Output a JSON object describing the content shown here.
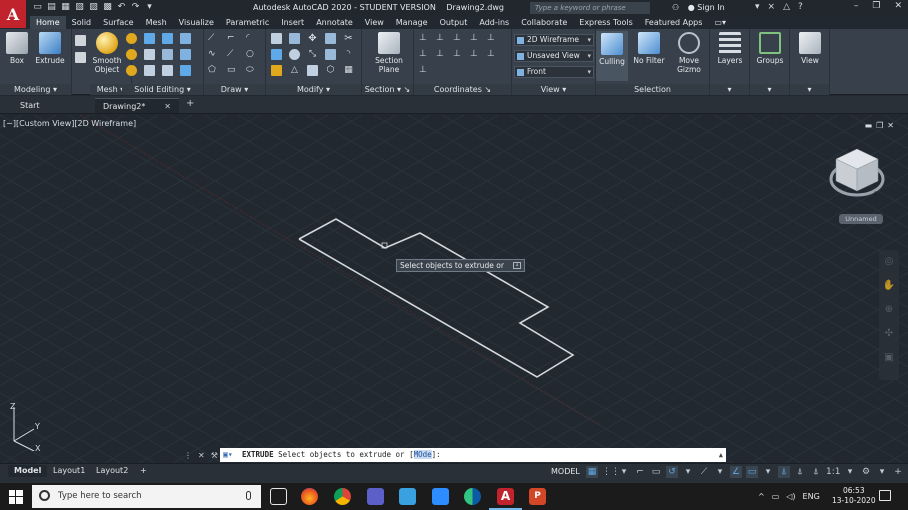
{
  "title_bar": {
    "app_name": "Autodesk AutoCAD 2020 - STUDENT VERSION",
    "document": "Drawing2.dwg",
    "search_placeholder": "Type a keyword or phrase",
    "signin_label": "Sign In",
    "logo_letter": "A"
  },
  "ribbon_tabs": [
    "Home",
    "Solid",
    "Surface",
    "Mesh",
    "Visualize",
    "Parametric",
    "Insert",
    "Annotate",
    "View",
    "Manage",
    "Output",
    "Add-ins",
    "Collaborate",
    "Express Tools",
    "Featured Apps"
  ],
  "ribbon": {
    "modeling": {
      "label": "Modeling",
      "box": "Box",
      "extrude": "Extrude"
    },
    "mesh": {
      "label": "Mesh",
      "smooth_object_1": "Smooth",
      "smooth_object_2": "Object"
    },
    "solid_editing": {
      "label": "Solid Editing"
    },
    "draw": {
      "label": "Draw"
    },
    "modify": {
      "label": "Modify"
    },
    "section": {
      "label": "Section",
      "section_plane_1": "Section",
      "section_plane_2": "Plane"
    },
    "coordinates": {
      "label": "Coordinates"
    },
    "view": {
      "label": "View",
      "visual_style": "2D Wireframe",
      "saved_view": "Unsaved View",
      "view_direction": "Front"
    },
    "selection": {
      "label": "Selection",
      "culling": "Culling",
      "no_filter": "No Filter",
      "move_gizmo_1": "Move",
      "move_gizmo_2": "Gizmo"
    },
    "layers": {
      "label": "Layers"
    },
    "groups": {
      "label": "Groups"
    },
    "view_btn": {
      "label": "View"
    }
  },
  "file_tabs": {
    "start": "Start",
    "drawing": "Drawing2*"
  },
  "viewport": {
    "label": "[−][Custom View][2D Wireframe]",
    "tooltip": "Select objects to extrude or",
    "viewcube_named": "Unnamed",
    "ucs_x": "X",
    "ucs_y": "Y",
    "ucs_z": "Z"
  },
  "command_line": {
    "command": "EXTRUDE",
    "prompt_before": " Select objects to extrude or [",
    "option": "MOde",
    "prompt_after": "]:"
  },
  "layout_tabs": [
    "Model",
    "Layout1",
    "Layout2"
  ],
  "status_bar": {
    "model_label": "MODEL",
    "scale": "1:1"
  },
  "taskbar": {
    "search_placeholder": "Type here to search",
    "language": "ENG",
    "time": "06:53",
    "date": "13-10-2020"
  },
  "colors": {
    "autocad_red": "#c0232b",
    "ribbon_bg": "#38414b",
    "viewport_bg": "#212830",
    "accent_blue": "#5fa9e8"
  }
}
